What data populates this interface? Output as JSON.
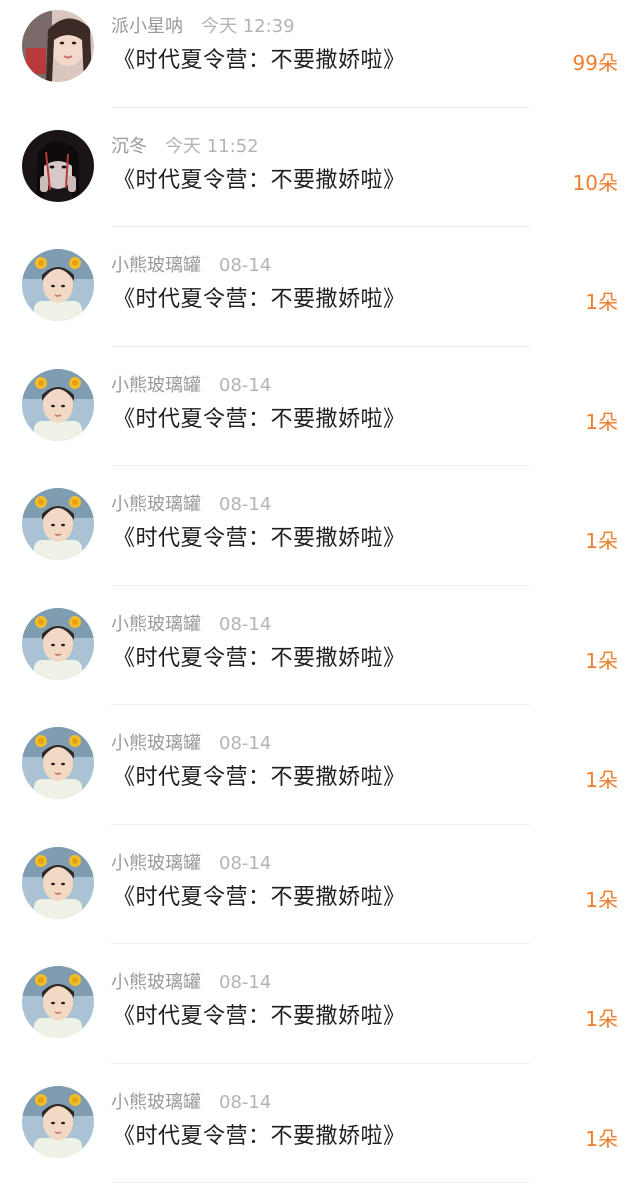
{
  "colors": {
    "count": "#ef7d2c",
    "username": "#9a9a9a",
    "title": "#1f1f1f"
  },
  "items": [
    {
      "username": "派小星呐",
      "time": "今天 12:39",
      "title": "《时代夏令营：不要撒娇啦》",
      "count": "99朵",
      "avatar": "girl-photo-avatar"
    },
    {
      "username": "沉冬",
      "time": "今天 11:52",
      "title": "《时代夏令营：不要撒娇啦》",
      "count": "10朵",
      "avatar": "dark-portrait-avatar"
    },
    {
      "username": "小熊玻璃罐",
      "time": "08-14",
      "title": "《时代夏令营：不要撒娇啦》",
      "count": "1朵",
      "avatar": "boy-bear-ears-avatar"
    },
    {
      "username": "小熊玻璃罐",
      "time": "08-14",
      "title": "《时代夏令营：不要撒娇啦》",
      "count": "1朵",
      "avatar": "boy-bear-ears-avatar"
    },
    {
      "username": "小熊玻璃罐",
      "time": "08-14",
      "title": "《时代夏令营：不要撒娇啦》",
      "count": "1朵",
      "avatar": "boy-bear-ears-avatar"
    },
    {
      "username": "小熊玻璃罐",
      "time": "08-14",
      "title": "《时代夏令营：不要撒娇啦》",
      "count": "1朵",
      "avatar": "boy-bear-ears-avatar"
    },
    {
      "username": "小熊玻璃罐",
      "time": "08-14",
      "title": "《时代夏令营：不要撒娇啦》",
      "count": "1朵",
      "avatar": "boy-bear-ears-avatar"
    },
    {
      "username": "小熊玻璃罐",
      "time": "08-14",
      "title": "《时代夏令营：不要撒娇啦》",
      "count": "1朵",
      "avatar": "boy-bear-ears-avatar"
    },
    {
      "username": "小熊玻璃罐",
      "time": "08-14",
      "title": "《时代夏令营：不要撒娇啦》",
      "count": "1朵",
      "avatar": "boy-bear-ears-avatar"
    },
    {
      "username": "小熊玻璃罐",
      "time": "08-14",
      "title": "《时代夏令营：不要撒娇啦》",
      "count": "1朵",
      "avatar": "boy-bear-ears-avatar"
    }
  ]
}
